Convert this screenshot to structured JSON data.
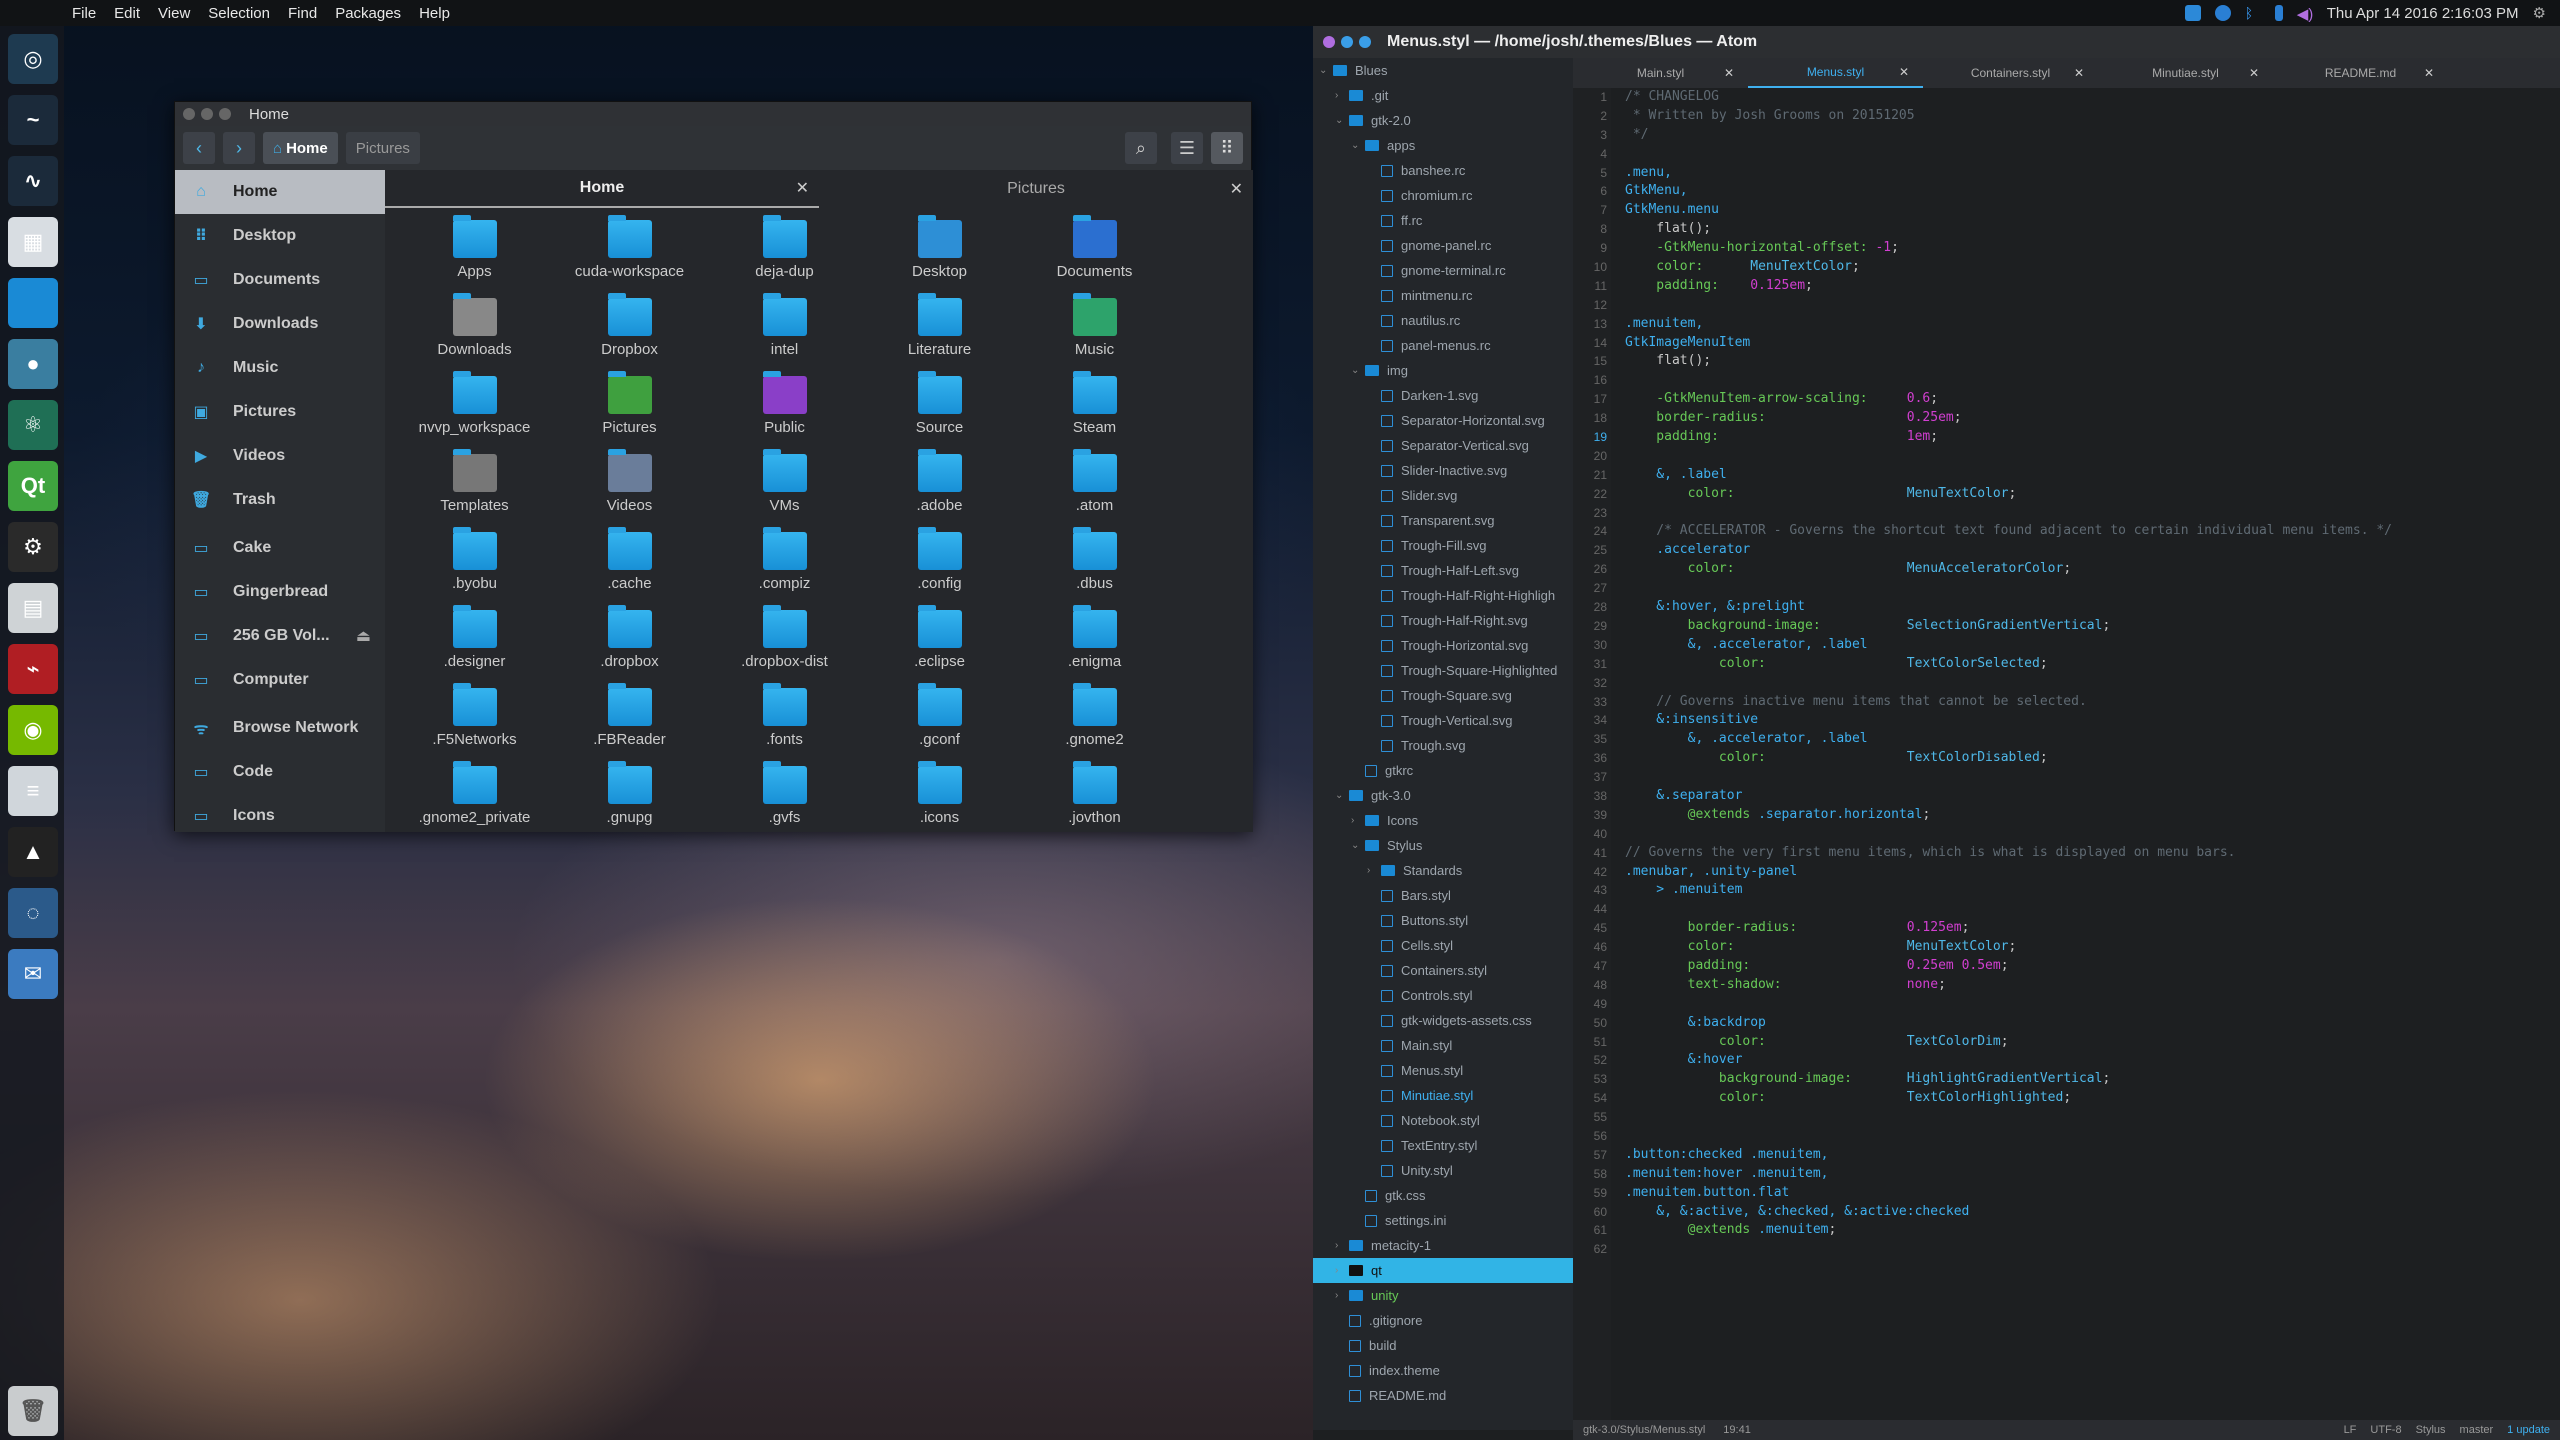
{
  "topbar": {
    "menus": [
      "File",
      "Edit",
      "View",
      "Selection",
      "Find",
      "Packages",
      "Help"
    ],
    "datetime": "Thu Apr 14 2016  2:16:03 PM"
  },
  "launcher": {
    "items": [
      {
        "name": "dash",
        "label": "◎",
        "color": "#1e3a50"
      },
      {
        "name": "terminal",
        "label": "~",
        "color": "#1b2a3a"
      },
      {
        "name": "system-monitor",
        "label": "∿",
        "color": "#1b2a3a"
      },
      {
        "name": "files",
        "label": "▦",
        "color": "#d8dde2"
      },
      {
        "name": "folder",
        "label": "",
        "color": "#1a8ad5"
      },
      {
        "name": "chromium",
        "label": "●",
        "color": "#3a7ea0"
      },
      {
        "name": "atom",
        "label": "⚛",
        "color": "#1f6f55"
      },
      {
        "name": "qt-creator",
        "label": "Qt",
        "color": "#3fa43f"
      },
      {
        "name": "settings",
        "label": "⚙",
        "color": "#2a2a2a"
      },
      {
        "name": "software",
        "label": "▤",
        "color": "#cfd3d6"
      },
      {
        "name": "pdf-reader",
        "label": "⌁",
        "color": "#b01e23"
      },
      {
        "name": "nvidia",
        "label": "◉",
        "color": "#76b900"
      },
      {
        "name": "text-editor",
        "label": "≡",
        "color": "#d0d6db"
      },
      {
        "name": "inkscape",
        "label": "▲",
        "color": "#222"
      },
      {
        "name": "web-browser",
        "label": "◌",
        "color": "#2b5a8a"
      },
      {
        "name": "mail",
        "label": "✉",
        "color": "#3b7bc0"
      }
    ],
    "trash_label": "Trash"
  },
  "files": {
    "window_title": "Home",
    "breadcrumbs": [
      "Home",
      "Pictures"
    ],
    "sidebar": [
      "Home",
      "Desktop",
      "Documents",
      "Downloads",
      "Music",
      "Pictures",
      "Videos",
      "Trash",
      "Cake",
      "Gingerbread",
      "256 GB Vol...",
      "Computer",
      "Browse Network",
      "Code",
      "Icons"
    ],
    "tabs": [
      "Home",
      "Pictures"
    ],
    "items": [
      "Apps",
      "cuda-workspace",
      "deja-dup",
      "Desktop",
      "Documents",
      "Downloads",
      "Dropbox",
      "intel",
      "Literature",
      "Music",
      "nvvp_workspace",
      "Pictures",
      "Public",
      "Source",
      "Steam",
      "Templates",
      "Videos",
      "VMs",
      ".adobe",
      ".atom",
      ".byobu",
      ".cache",
      ".compiz",
      ".config",
      ".dbus",
      ".designer",
      ".dropbox",
      ".dropbox-dist",
      ".eclipse",
      ".enigma",
      ".F5Networks",
      ".FBReader",
      ".fonts",
      ".gconf",
      ".gnome2",
      ".gnome2_private",
      ".gnupg",
      ".gvfs",
      ".icons",
      ".jovthon"
    ]
  },
  "atom": {
    "window_title": "Menus.styl — /home/josh/.themes/Blues — Atom",
    "tabs": [
      "Main.styl",
      "Menus.styl",
      "Containers.styl",
      "Minutiae.styl",
      "README.md"
    ],
    "active_tab": 1,
    "tree": [
      {
        "t": "Blues",
        "d": 0,
        "k": "root"
      },
      {
        "t": ".git",
        "d": 1,
        "k": "fold-c"
      },
      {
        "t": "gtk-2.0",
        "d": 1,
        "k": "fold-o"
      },
      {
        "t": "apps",
        "d": 2,
        "k": "fold-o"
      },
      {
        "t": "banshee.rc",
        "d": 3,
        "k": "file"
      },
      {
        "t": "chromium.rc",
        "d": 3,
        "k": "file"
      },
      {
        "t": "ff.rc",
        "d": 3,
        "k": "file"
      },
      {
        "t": "gnome-panel.rc",
        "d": 3,
        "k": "file"
      },
      {
        "t": "gnome-terminal.rc",
        "d": 3,
        "k": "file"
      },
      {
        "t": "mintmenu.rc",
        "d": 3,
        "k": "file"
      },
      {
        "t": "nautilus.rc",
        "d": 3,
        "k": "file"
      },
      {
        "t": "panel-menus.rc",
        "d": 3,
        "k": "file"
      },
      {
        "t": "img",
        "d": 2,
        "k": "fold-o"
      },
      {
        "t": "Darken-1.svg",
        "d": 3,
        "k": "file"
      },
      {
        "t": "Separator-Horizontal.svg",
        "d": 3,
        "k": "file"
      },
      {
        "t": "Separator-Vertical.svg",
        "d": 3,
        "k": "file"
      },
      {
        "t": "Slider-Inactive.svg",
        "d": 3,
        "k": "file"
      },
      {
        "t": "Slider.svg",
        "d": 3,
        "k": "file"
      },
      {
        "t": "Transparent.svg",
        "d": 3,
        "k": "file"
      },
      {
        "t": "Trough-Fill.svg",
        "d": 3,
        "k": "file"
      },
      {
        "t": "Trough-Half-Left.svg",
        "d": 3,
        "k": "file"
      },
      {
        "t": "Trough-Half-Right-Highligh",
        "d": 3,
        "k": "file"
      },
      {
        "t": "Trough-Half-Right.svg",
        "d": 3,
        "k": "file"
      },
      {
        "t": "Trough-Horizontal.svg",
        "d": 3,
        "k": "file"
      },
      {
        "t": "Trough-Square-Highlighted",
        "d": 3,
        "k": "file"
      },
      {
        "t": "Trough-Square.svg",
        "d": 3,
        "k": "file"
      },
      {
        "t": "Trough-Vertical.svg",
        "d": 3,
        "k": "file"
      },
      {
        "t": "Trough.svg",
        "d": 3,
        "k": "file"
      },
      {
        "t": "gtkrc",
        "d": 2,
        "k": "file"
      },
      {
        "t": "gtk-3.0",
        "d": 1,
        "k": "fold-o"
      },
      {
        "t": "Icons",
        "d": 2,
        "k": "fold-c"
      },
      {
        "t": "Stylus",
        "d": 2,
        "k": "fold-o"
      },
      {
        "t": "Standards",
        "d": 3,
        "k": "fold-c"
      },
      {
        "t": "Bars.styl",
        "d": 3,
        "k": "file"
      },
      {
        "t": "Buttons.styl",
        "d": 3,
        "k": "file"
      },
      {
        "t": "Cells.styl",
        "d": 3,
        "k": "file"
      },
      {
        "t": "Containers.styl",
        "d": 3,
        "k": "file"
      },
      {
        "t": "Controls.styl",
        "d": 3,
        "k": "file"
      },
      {
        "t": "gtk-widgets-assets.css",
        "d": 3,
        "k": "file"
      },
      {
        "t": "Main.styl",
        "d": 3,
        "k": "file"
      },
      {
        "t": "Menus.styl",
        "d": 3,
        "k": "file"
      },
      {
        "t": "Minutiae.styl",
        "d": 3,
        "k": "file"
      },
      {
        "t": "Notebook.styl",
        "d": 3,
        "k": "file"
      },
      {
        "t": "TextEntry.styl",
        "d": 3,
        "k": "file"
      },
      {
        "t": "Unity.styl",
        "d": 3,
        "k": "file"
      },
      {
        "t": "gtk.css",
        "d": 2,
        "k": "file"
      },
      {
        "t": "settings.ini",
        "d": 2,
        "k": "file"
      },
      {
        "t": "metacity-1",
        "d": 1,
        "k": "fold-c"
      },
      {
        "t": "qt",
        "d": 1,
        "k": "fold-c",
        "sel": true
      },
      {
        "t": "unity",
        "d": 1,
        "k": "fold-c"
      },
      {
        "t": ".gitignore",
        "d": 1,
        "k": "file"
      },
      {
        "t": "build",
        "d": 1,
        "k": "file"
      },
      {
        "t": "index.theme",
        "d": 1,
        "k": "file"
      },
      {
        "t": "README.md",
        "d": 1,
        "k": "file"
      }
    ],
    "cursor_line": 19,
    "code": [
      [
        [
          "c-com",
          "/* CHANGELOG"
        ]
      ],
      [
        [
          "c-com",
          " * Written by Josh Grooms on 20151205"
        ]
      ],
      [
        [
          "c-com",
          " */"
        ]
      ],
      [],
      [
        [
          "c-sel",
          ".menu,"
        ]
      ],
      [
        [
          "c-sel",
          "GtkMenu,"
        ]
      ],
      [
        [
          "c-sel",
          "GtkMenu.menu"
        ]
      ],
      [
        [
          "c-def",
          "    flat();"
        ]
      ],
      [
        [
          "c-prop",
          "    -GtkMenu-horizontal-offset: "
        ],
        [
          "c-val",
          "-1"
        ],
        [
          "c-def",
          ";"
        ]
      ],
      [
        [
          "c-prop",
          "    color:"
        ],
        [
          "c-def",
          "      "
        ],
        [
          "c-var",
          "MenuTextColor"
        ],
        [
          "c-def",
          ";"
        ]
      ],
      [
        [
          "c-prop",
          "    padding:"
        ],
        [
          "c-def",
          "    "
        ],
        [
          "c-val",
          "0.125em"
        ],
        [
          "c-def",
          ";"
        ]
      ],
      [],
      [
        [
          "c-sel",
          ".menuitem,"
        ]
      ],
      [
        [
          "c-sel",
          "GtkImageMenuItem"
        ]
      ],
      [
        [
          "c-def",
          "    flat();"
        ]
      ],
      [],
      [
        [
          "c-prop",
          "    -GtkMenuItem-arrow-scaling:"
        ],
        [
          "c-def",
          "     "
        ],
        [
          "c-val",
          "0.6"
        ],
        [
          "c-def",
          ";"
        ]
      ],
      [
        [
          "c-prop",
          "    border-radius:"
        ],
        [
          "c-def",
          "                  "
        ],
        [
          "c-val",
          "0.25em"
        ],
        [
          "c-def",
          ";"
        ]
      ],
      [
        [
          "c-prop",
          "    padding:"
        ],
        [
          "c-def",
          "                        "
        ],
        [
          "c-val",
          "1em"
        ],
        [
          "c-def",
          ";"
        ]
      ],
      [],
      [
        [
          "c-sel",
          "    &, .label"
        ]
      ],
      [
        [
          "c-prop",
          "        color:"
        ],
        [
          "c-def",
          "                      "
        ],
        [
          "c-var",
          "MenuTextColor"
        ],
        [
          "c-def",
          ";"
        ]
      ],
      [],
      [
        [
          "c-com",
          "    /* ACCELERATOR - Governs the shortcut text found adjacent to certain individual menu items. */"
        ]
      ],
      [
        [
          "c-sel",
          "    .accelerator"
        ]
      ],
      [
        [
          "c-prop",
          "        color:"
        ],
        [
          "c-def",
          "                      "
        ],
        [
          "c-var",
          "MenuAcceleratorColor"
        ],
        [
          "c-def",
          ";"
        ]
      ],
      [],
      [
        [
          "c-sel",
          "    &:hover, &:prelight"
        ]
      ],
      [
        [
          "c-prop",
          "        background-image:"
        ],
        [
          "c-def",
          "           "
        ],
        [
          "c-var",
          "SelectionGradientVertical"
        ],
        [
          "c-def",
          ";"
        ]
      ],
      [
        [
          "c-sel",
          "        &, .accelerator, .label"
        ]
      ],
      [
        [
          "c-prop",
          "            color:"
        ],
        [
          "c-def",
          "                  "
        ],
        [
          "c-var",
          "TextColorSelected"
        ],
        [
          "c-def",
          ";"
        ]
      ],
      [],
      [
        [
          "c-com",
          "    // Governs inactive menu items that cannot be selected."
        ]
      ],
      [
        [
          "c-sel",
          "    &:insensitive"
        ]
      ],
      [
        [
          "c-sel",
          "        &, .accelerator, .label"
        ]
      ],
      [
        [
          "c-prop",
          "            color:"
        ],
        [
          "c-def",
          "                  "
        ],
        [
          "c-var",
          "TextColorDisabled"
        ],
        [
          "c-def",
          ";"
        ]
      ],
      [],
      [
        [
          "c-sel",
          "    &.separator"
        ]
      ],
      [
        [
          "c-prop",
          "        @extends "
        ],
        [
          "c-sel",
          ".separator.horizontal"
        ],
        [
          "c-def",
          ";"
        ]
      ],
      [],
      [
        [
          "c-com",
          "// Governs the very first menu items, which is what is displayed on menu bars."
        ]
      ],
      [
        [
          "c-sel",
          ".menubar, .unity-panel"
        ]
      ],
      [
        [
          "c-sel",
          "    > .menuitem"
        ]
      ],
      [],
      [
        [
          "c-prop",
          "        border-radius:"
        ],
        [
          "c-def",
          "              "
        ],
        [
          "c-val",
          "0.125em"
        ],
        [
          "c-def",
          ";"
        ]
      ],
      [
        [
          "c-prop",
          "        color:"
        ],
        [
          "c-def",
          "                      "
        ],
        [
          "c-var",
          "MenuTextColor"
        ],
        [
          "c-def",
          ";"
        ]
      ],
      [
        [
          "c-prop",
          "        padding:"
        ],
        [
          "c-def",
          "                    "
        ],
        [
          "c-val",
          "0.25em 0.5em"
        ],
        [
          "c-def",
          ";"
        ]
      ],
      [
        [
          "c-prop",
          "        text-shadow:"
        ],
        [
          "c-def",
          "                "
        ],
        [
          "c-val",
          "none"
        ],
        [
          "c-def",
          ";"
        ]
      ],
      [],
      [
        [
          "c-sel",
          "        &:backdrop"
        ]
      ],
      [
        [
          "c-prop",
          "            color:"
        ],
        [
          "c-def",
          "                  "
        ],
        [
          "c-var",
          "TextColorDim"
        ],
        [
          "c-def",
          ";"
        ]
      ],
      [
        [
          "c-sel",
          "        &:hover"
        ]
      ],
      [
        [
          "c-prop",
          "            background-image:"
        ],
        [
          "c-def",
          "       "
        ],
        [
          "c-var",
          "HighlightGradientVertical"
        ],
        [
          "c-def",
          ";"
        ]
      ],
      [
        [
          "c-prop",
          "            color:"
        ],
        [
          "c-def",
          "                  "
        ],
        [
          "c-var",
          "TextColorHighlighted"
        ],
        [
          "c-def",
          ";"
        ]
      ],
      [],
      [],
      [
        [
          "c-sel",
          ".button:checked .menuitem,"
        ]
      ],
      [
        [
          "c-sel",
          ".menuitem:hover .menuitem,"
        ]
      ],
      [
        [
          "c-sel",
          ".menuitem.button.flat"
        ]
      ],
      [
        [
          "c-sel",
          "    &, &:active, &:checked, &:active:checked"
        ]
      ],
      [
        [
          "c-prop",
          "        @extends "
        ],
        [
          "c-sel",
          ".menuitem"
        ],
        [
          "c-def",
          ";"
        ]
      ],
      []
    ],
    "status": {
      "path": "gtk-3.0/Stylus/Menus.styl",
      "position": "19:41",
      "eol": "LF",
      "encoding": "UTF-8",
      "grammar": "Stylus",
      "branch": "master",
      "updates": "1 update"
    }
  }
}
